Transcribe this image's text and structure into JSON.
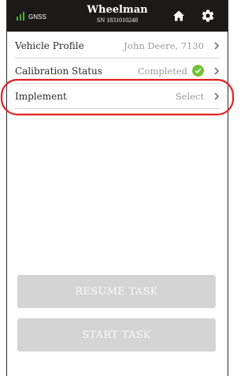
{
  "header": {
    "gnss_label": "GNSS",
    "title": "Wheelman",
    "serial": "SN 1831010248",
    "home_icon": "home-icon",
    "settings_icon": "gear-icon"
  },
  "rows": [
    {
      "label": "Vehicle Profile",
      "value": "John Deere, 7130"
    },
    {
      "label": "Calibration Status",
      "value": "Completed",
      "status_icon": "check-circle-icon"
    },
    {
      "label": "Implement",
      "value": "Select"
    }
  ],
  "buttons": {
    "resume": "RESUME TASK",
    "start": "START TASK"
  },
  "colors": {
    "header_bg": "#1c1a19",
    "signal_green": "#4caf2e",
    "check_green": "#74c23a",
    "button_disabled": "#d4d4d4",
    "annotation_red": "#e32222"
  }
}
